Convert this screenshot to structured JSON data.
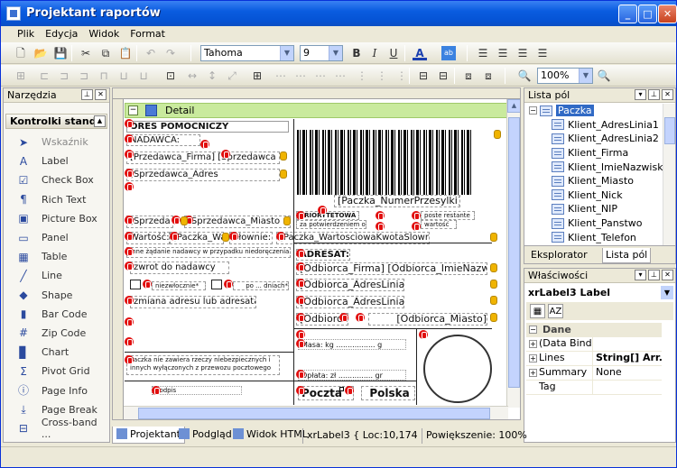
{
  "window": {
    "title": "Projektant raportów"
  },
  "menu": [
    "Plik",
    "Edycja",
    "Widok",
    "Format"
  ],
  "toolbar": {
    "font": "Tahoma",
    "size": "9",
    "zoom": "100%"
  },
  "tools_panel": {
    "title": "Narzędzia",
    "group": "Kontrolki standa",
    "items": [
      {
        "label": "Wskaźnik",
        "icon": "pointer-icon"
      },
      {
        "label": "Label",
        "icon": "label-icon"
      },
      {
        "label": "Check Box",
        "icon": "checkbox-icon"
      },
      {
        "label": "Rich Text",
        "icon": "richtext-icon"
      },
      {
        "label": "Picture Box",
        "icon": "picture-icon"
      },
      {
        "label": "Panel",
        "icon": "panel-icon"
      },
      {
        "label": "Table",
        "icon": "table-icon"
      },
      {
        "label": "Line",
        "icon": "line-icon"
      },
      {
        "label": "Shape",
        "icon": "shape-icon"
      },
      {
        "label": "Bar Code",
        "icon": "barcode-icon"
      },
      {
        "label": "Zip Code",
        "icon": "zipcode-icon"
      },
      {
        "label": "Chart",
        "icon": "chart-icon"
      },
      {
        "label": "Pivot Grid",
        "icon": "pivot-icon"
      },
      {
        "label": "Page Info",
        "icon": "pageinfo-icon"
      },
      {
        "label": "Page Break",
        "icon": "pagebreak-icon"
      },
      {
        "label": "Cross-band ...",
        "icon": "crossband-icon"
      }
    ]
  },
  "designer": {
    "band": "Detail",
    "labels": {
      "header": "ORES POMOCNICZY",
      "nadawca": "NADAWCA:",
      "firma": "[Przedawca_Firma] [Sprzedawca",
      "adres": "[Sprzedawca_Adres",
      "miasto_a": "[Sprzeda",
      "miasto_b": "[Sprzedawca_Miasto",
      "wartosc_a": "Wartość:",
      "wartosc_b": "[Paczka_Wa",
      "wartosc_c": "Słownie:",
      "wartosc_d": "[Paczka_WartosciowaKwotaSlownie]",
      "zadanie": "Inne żądanie nadawcy w przypadku niedoręczenia paczki:",
      "zwrot": "zwrot do nadawcy",
      "natychmiast": "natychmiastowo",
      "niezwlocznie": "niezwłocznie*",
      "po_dniach": "po ... dniach*",
      "zmiana": "zmiana adresu lub adresata",
      "zawartosc": "Paczka nie zawiera rzeczy niebezpiecznych i innych wyłączonych z przewozu pocztowego",
      "podpis": "podpis",
      "barcode": "[Paczka_NumerPrzesylki]",
      "priorytetowa": "PRIORYTETOWA",
      "za_potw": "za potwierdzeniem odbioru",
      "poste": "poste restante",
      "wartosc_r": "wartość",
      "adresat": "ADRESAT:",
      "odb_firma": "[Odbiorca_Firma] [Odbiorca_ImieNazwisko]",
      "odb_adr1": "[Odbiorca_AdresLinia1]",
      "odb_adr2": "[Odbiorca_AdresLinia2]",
      "odb_kod": "[Odbiorca",
      "odb_miasto": "[Odbiorca_Miasto]",
      "masa": "Masa: kg ................. g",
      "oplata": "Opłata: zł ............... gr",
      "poczta": "Poczta",
      "polska": "Polska"
    }
  },
  "fields_panel": {
    "title": "Lista pól",
    "root": "Paczka",
    "fields": [
      "Klient_AdresLinia1",
      "Klient_AdresLinia2",
      "Klient_Firma",
      "Klient_ImieNazwisko",
      "Klient_Miasto",
      "Klient_Nick",
      "Klient_NIP",
      "Klient_Panstwo",
      "Klient_Telefon"
    ],
    "tabs": [
      "Eksplorator",
      "Lista pól"
    ]
  },
  "props_panel": {
    "title": "Właściwości",
    "selected": "xrLabel3  Label",
    "category": "Dane",
    "rows": [
      {
        "k": "(Data Bindi",
        "v": "",
        "exp": true
      },
      {
        "k": "Lines",
        "v": "String[] Arr...",
        "exp": true,
        "bold": true
      },
      {
        "k": "Summary",
        "v": "None",
        "exp": true
      },
      {
        "k": "Tag",
        "v": "",
        "exp": false
      }
    ]
  },
  "view_tabs": [
    "Projektant",
    "Podgląd",
    "Widok HTML"
  ],
  "status": {
    "element": "xrLabel3 { Loc:10,174 Size:5",
    "zoom": "Powiększenie: 100%"
  }
}
